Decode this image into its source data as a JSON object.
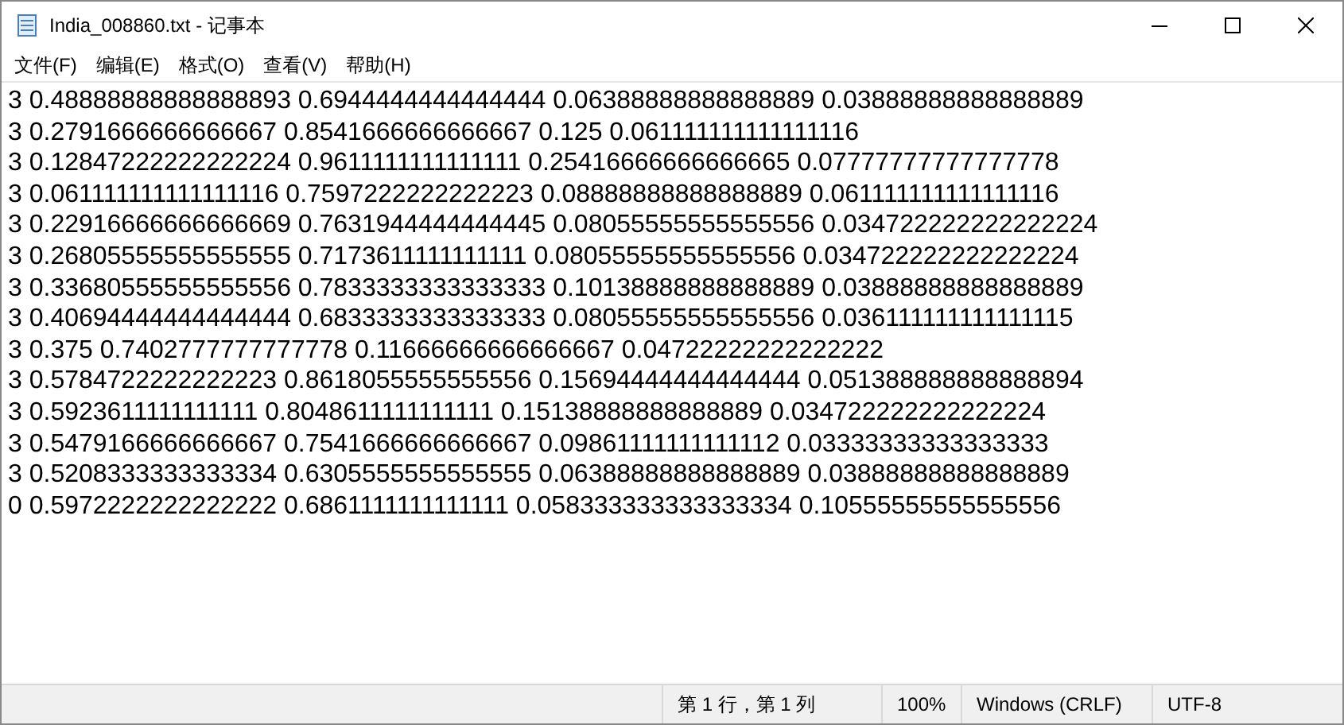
{
  "window": {
    "title": "India_008860.txt - 记事本"
  },
  "menu": [
    "文件(F)",
    "编辑(E)",
    "格式(O)",
    "查看(V)",
    "帮助(H)"
  ],
  "editor": {
    "lines": [
      "3 0.48888888888888893 0.6944444444444444 0.06388888888888889 0.03888888888888889",
      "3 0.2791666666666667 0.8541666666666667 0.125 0.061111111111111116",
      "3 0.12847222222222224 0.9611111111111111 0.25416666666666665 0.07777777777777778",
      "3 0.061111111111111116 0.7597222222222223 0.08888888888888889 0.061111111111111116",
      "3 0.22916666666666669 0.7631944444444445 0.08055555555555556 0.034722222222222224",
      "3 0.26805555555555555 0.7173611111111111 0.08055555555555556 0.034722222222222224",
      "3 0.33680555555555556 0.7833333333333333 0.10138888888888889 0.03888888888888889",
      "3 0.40694444444444444 0.6833333333333333 0.08055555555555556 0.036111111111111115",
      "3 0.375 0.7402777777777778 0.11666666666666667 0.04722222222222222",
      "3 0.5784722222222223 0.8618055555555556 0.15694444444444444 0.051388888888888894",
      "3 0.5923611111111111 0.8048611111111111 0.15138888888888889 0.034722222222222224",
      "3 0.5479166666666667 0.7541666666666667 0.09861111111111112 0.03333333333333333",
      "3 0.5208333333333334 0.6305555555555555 0.06388888888888889 0.03888888888888889",
      "0 0.5972222222222222 0.6861111111111111 0.058333333333333334 0.10555555555555556"
    ]
  },
  "status_bar": {
    "position": "第 1 行，第 1 列",
    "zoom": "100%",
    "line_ending": "Windows (CRLF)",
    "encoding": "UTF-8"
  }
}
